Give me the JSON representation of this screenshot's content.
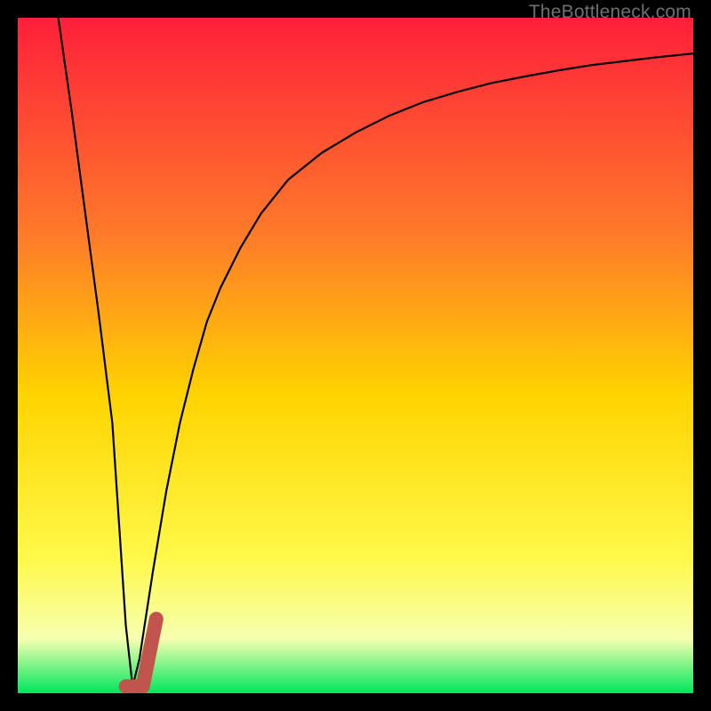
{
  "watermark": "TheBottleneck.com",
  "colors": {
    "frame": "#000000",
    "gradient_top": "#ff1f3a",
    "gradient_mid_upper": "#ff7a2a",
    "gradient_mid": "#ffd400",
    "gradient_mid_lower": "#fff94a",
    "gradient_pale": "#f6ffb0",
    "gradient_bottom": "#00e65c",
    "curve": "#000000",
    "marker": "#c1554e"
  },
  "chart_data": {
    "type": "line",
    "title": "",
    "xlabel": "",
    "ylabel": "",
    "xlim": [
      0,
      100
    ],
    "ylim": [
      0,
      100
    ],
    "series": [
      {
        "name": "bottleneck-curve",
        "x": [
          6,
          8,
          10,
          12,
          14,
          15,
          16,
          17,
          18,
          20,
          22,
          24,
          26,
          28,
          30,
          33,
          36,
          40,
          45,
          50,
          55,
          60,
          65,
          70,
          75,
          80,
          85,
          90,
          95,
          100
        ],
        "values": [
          100,
          86,
          71,
          56,
          40,
          25,
          10,
          1,
          5,
          18,
          30,
          40,
          48,
          55,
          60,
          66,
          71,
          76,
          80,
          83,
          85.5,
          87.5,
          89,
          90.3,
          91.3,
          92.2,
          93,
          93.6,
          94.2,
          94.7
        ]
      }
    ],
    "marker": {
      "name": "current-point",
      "path": [
        {
          "x": 16.0,
          "y": 1.0
        },
        {
          "x": 18.5,
          "y": 1.0
        },
        {
          "x": 20.5,
          "y": 11.0
        }
      ]
    }
  }
}
